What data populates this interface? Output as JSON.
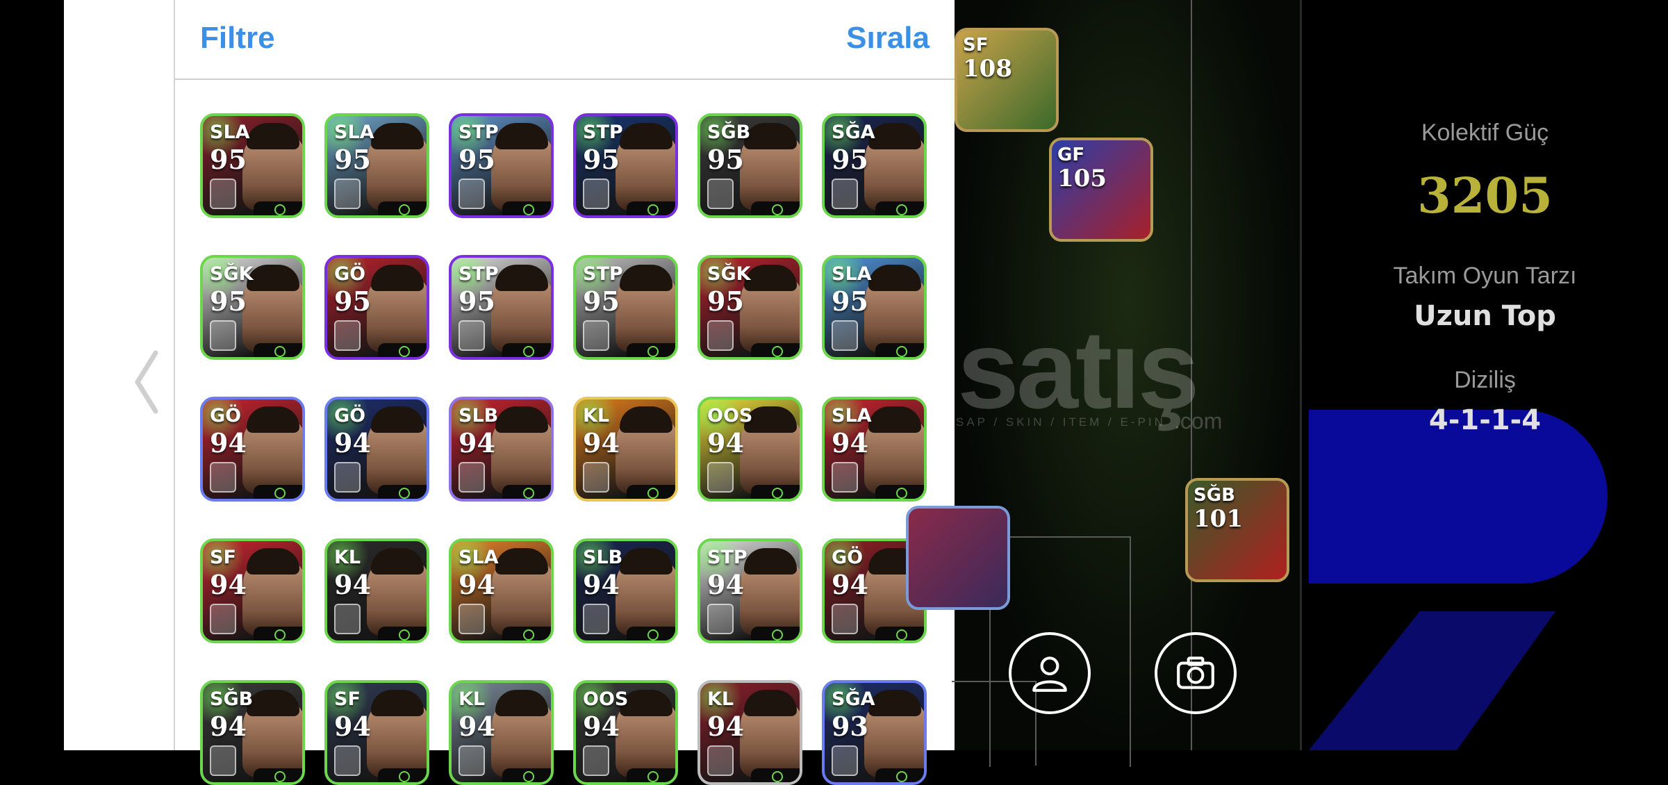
{
  "header": {
    "filter_label": "Filtre",
    "sort_label": "Sırala"
  },
  "cards": [
    {
      "pos": "SLA",
      "ovr": "95",
      "bg": "#8a1f2a",
      "border": "#6cd64c"
    },
    {
      "pos": "SLA",
      "ovr": "95",
      "bg": "#6fa3c9",
      "border": "#6cd64c"
    },
    {
      "pos": "STP",
      "ovr": "95",
      "bg": "#5f8fc4",
      "border": "#7a2fe0"
    },
    {
      "pos": "STP",
      "ovr": "95",
      "bg": "#17356e",
      "border": "#7a2fe0"
    },
    {
      "pos": "SĞB",
      "ovr": "95",
      "bg": "#3b3b3b",
      "border": "#6cd64c"
    },
    {
      "pos": "SĞA",
      "ovr": "95",
      "bg": "#1a2552",
      "border": "#6cd64c"
    },
    {
      "pos": "SĞK",
      "ovr": "95",
      "bg": "#d9d9d9",
      "border": "#6cd64c"
    },
    {
      "pos": "GÖ",
      "ovr": "95",
      "bg": "#b8222e",
      "border": "#7a2fe0"
    },
    {
      "pos": "STP",
      "ovr": "95",
      "bg": "#d9d9d9",
      "border": "#7a2fe0"
    },
    {
      "pos": "STP",
      "ovr": "95",
      "bg": "#bdbdbd",
      "border": "#6cd64c"
    },
    {
      "pos": "SĞK",
      "ovr": "95",
      "bg": "#b8222e",
      "border": "#6cd64c"
    },
    {
      "pos": "SLA",
      "ovr": "95",
      "bg": "#4f93d9",
      "border": "#6cd64c"
    },
    {
      "pos": "GÖ",
      "ovr": "94",
      "bg": "#c9232f",
      "border": "#6a7cf0"
    },
    {
      "pos": "GÖ",
      "ovr": "94",
      "bg": "#1d2d6b",
      "border": "#6a7cf0"
    },
    {
      "pos": "SLB",
      "ovr": "94",
      "bg": "#c9232f",
      "border": "#8e74e8"
    },
    {
      "pos": "KL",
      "ovr": "94",
      "bg": "#e07c1c",
      "border": "#e8c65a"
    },
    {
      "pos": "OOS",
      "ovr": "94",
      "bg": "#e8d93a",
      "border": "#6cd64c"
    },
    {
      "pos": "SLA",
      "ovr": "94",
      "bg": "#c9232f",
      "border": "#6cd64c"
    },
    {
      "pos": "SF",
      "ovr": "94",
      "bg": "#c9232f",
      "border": "#6cd64c"
    },
    {
      "pos": "KL",
      "ovr": "94",
      "bg": "#2b2b2b",
      "border": "#6cd64c"
    },
    {
      "pos": "SLA",
      "ovr": "94",
      "bg": "#e6802a",
      "border": "#6cd64c"
    },
    {
      "pos": "SLB",
      "ovr": "94",
      "bg": "#1a2552",
      "border": "#6cd64c"
    },
    {
      "pos": "STP",
      "ovr": "94",
      "bg": "#dcdcdc",
      "border": "#6cd64c"
    },
    {
      "pos": "GÖ",
      "ovr": "94",
      "bg": "#8f1f26",
      "border": "#6cd64c"
    },
    {
      "pos": "SĞB",
      "ovr": "94",
      "bg": "#3a3a3a",
      "border": "#6cd64c"
    },
    {
      "pos": "SF",
      "ovr": "94",
      "bg": "#2f3a52",
      "border": "#6cd64c"
    },
    {
      "pos": "KL",
      "ovr": "94",
      "bg": "#7a8a9a",
      "border": "#6cd64c"
    },
    {
      "pos": "OOS",
      "ovr": "94",
      "bg": "#3a3a3a",
      "border": "#6cd64c"
    },
    {
      "pos": "KL",
      "ovr": "94",
      "bg": "#8a1f2a",
      "border": "#bcbcbc"
    },
    {
      "pos": "SĞA",
      "ovr": "93",
      "bg": "#1d2d6b",
      "border": "#6a7cf0"
    }
  ],
  "squad_cards": [
    {
      "pos": "SF",
      "ovr": "108"
    },
    {
      "pos": "GF",
      "ovr": "105"
    },
    {
      "pos": "SĞB",
      "ovr": "101"
    }
  ],
  "stats": {
    "power_label": "Kolektif Güç",
    "power_value": "3205",
    "style_label": "Takım Oyun Tarzı",
    "style_value": "Uzun Top",
    "formation_label": "Diziliş",
    "formation_value": "4-1-1-4"
  },
  "watermark": {
    "brand": "satış",
    "domain": ".com",
    "tagline": "SAP / SKIN / ITEM / E-PIN"
  },
  "icons": {
    "profile": "person-icon",
    "camera": "camera-icon",
    "back": "chevron-left-icon"
  }
}
